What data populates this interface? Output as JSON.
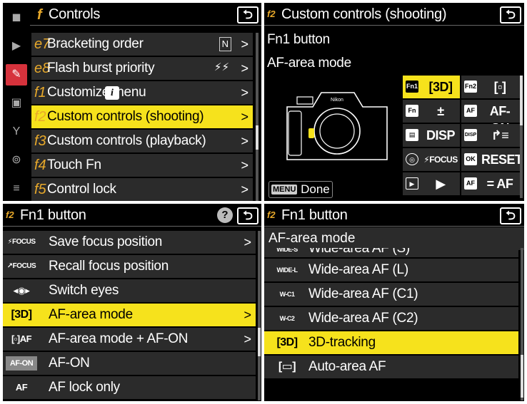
{
  "panel1": {
    "title": "Controls",
    "back": "⮌",
    "sidebar": [
      "camera-icon",
      "movie-icon",
      "pencil-icon",
      "playback-icon",
      "wrench-icon",
      "network-icon",
      "my-menu-icon"
    ],
    "items": [
      {
        "code": "e7",
        "label": "Bracketing order",
        "value": "N",
        "arrow": ">"
      },
      {
        "code": "e8",
        "label": "Flash burst priority",
        "value": "⚡⚡",
        "arrow": ">"
      },
      {
        "code": "f1",
        "label": "Customize  menu",
        "badge": "i",
        "arrow": ">"
      },
      {
        "code": "f2",
        "label": "Custom controls (shooting)",
        "arrow": ">",
        "selected": true
      },
      {
        "code": "f3",
        "label": "Custom controls (playback)",
        "arrow": ">"
      },
      {
        "code": "f4",
        "label": "Touch Fn",
        "arrow": ">"
      },
      {
        "code": "f5",
        "label": "Control lock",
        "arrow": ">"
      }
    ]
  },
  "panel2": {
    "code": "f2",
    "title": "Custom controls (shooting)",
    "back": "⮌",
    "line1": "Fn1 button",
    "line2": "AF-area mode",
    "grid": [
      {
        "icon": "Fn1",
        "value": "[3D]",
        "selected": true
      },
      {
        "icon": "Fn2",
        "value": "[▫]"
      },
      {
        "icon": "Fn",
        "value": "±"
      },
      {
        "icon": "AF",
        "value": "AF-ON"
      },
      {
        "icon": "▤",
        "value": "DISP"
      },
      {
        "icon": "DISP",
        "value": "↱≡"
      },
      {
        "icon": "◎",
        "value": "⚡FOCUS"
      },
      {
        "icon": "OK",
        "value": "RESET"
      },
      {
        "icon": "▶",
        "value": "▶"
      },
      {
        "icon": "AF",
        "value": "= AF"
      }
    ],
    "menu_badge": "MENU",
    "done_label": "Done"
  },
  "panel3": {
    "code": "f2",
    "title": "Fn1 button",
    "help": "?",
    "back": "⮌",
    "items": [
      {
        "icon": "⚡FOCUS",
        "label": "Save focus position",
        "arrow": ">"
      },
      {
        "icon": "↗FOCUS",
        "label": "Recall focus position"
      },
      {
        "icon": "◂◉▸",
        "label": "Switch eyes"
      },
      {
        "icon": "[3D]",
        "label": "AF-area mode",
        "arrow": ">",
        "selected": true
      },
      {
        "icon": "[▫]AF",
        "label": "AF-area mode + AF-ON",
        "arrow": ">"
      },
      {
        "icon": "AF-ON",
        "label": "AF-ON"
      },
      {
        "icon": "AF",
        "label": "AF lock only"
      }
    ]
  },
  "panel4": {
    "code": "f2",
    "title": "Fn1 button",
    "back": "⮌",
    "subtitle": "AF-area mode",
    "items": [
      {
        "icon": "WIDE-S",
        "label": "Wide-area AF (S)"
      },
      {
        "icon": "WIDE-L",
        "label": "Wide-area AF (L)"
      },
      {
        "icon": "W-C1",
        "label": "Wide-area AF (C1)"
      },
      {
        "icon": "W-C2",
        "label": "Wide-area AF (C2)"
      },
      {
        "icon": "[3D]",
        "label": "3D-tracking",
        "selected": true
      },
      {
        "icon": "[▭]",
        "label": "Auto-area AF"
      }
    ]
  }
}
